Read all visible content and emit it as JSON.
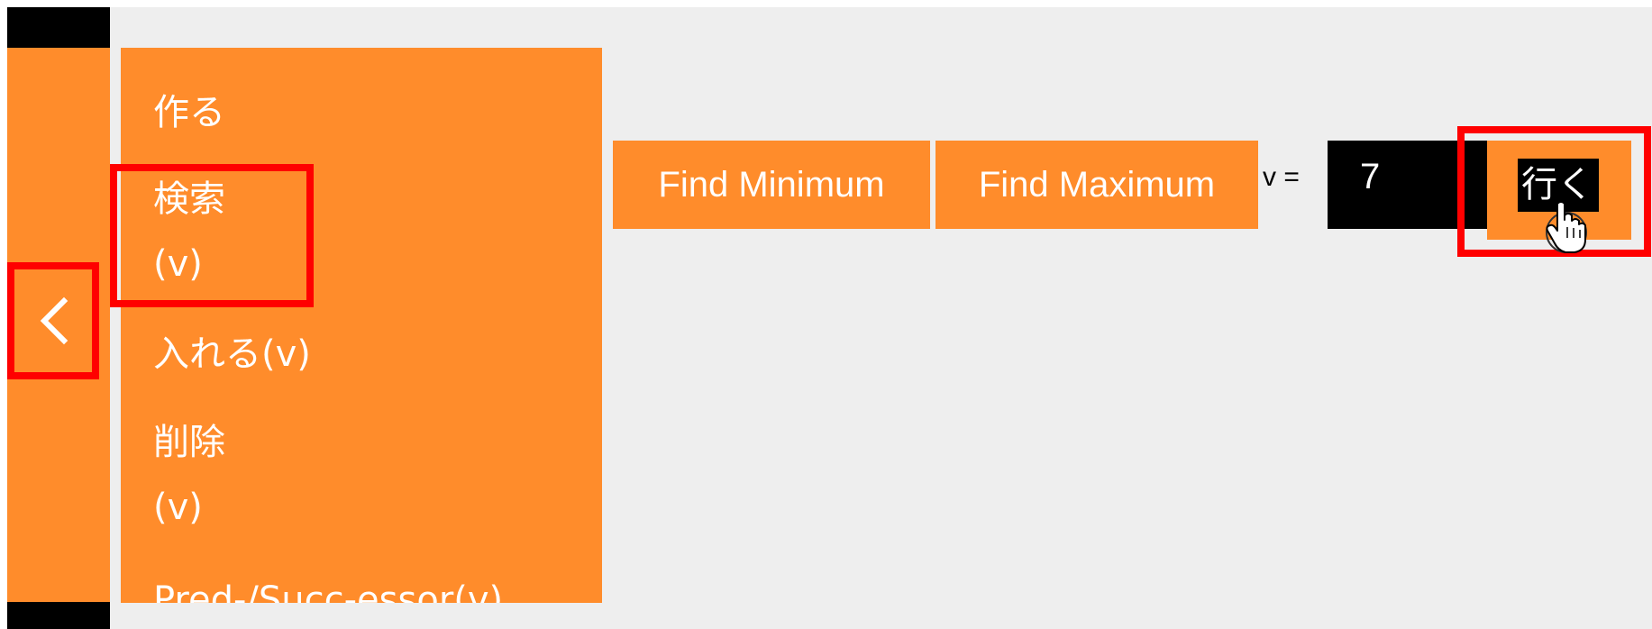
{
  "sidebar": {
    "collapse_icon": "chevron-left-icon",
    "menu": {
      "create": "作る",
      "search_line1": "検索",
      "search_line2": "(v)",
      "insert": "入れる(v)",
      "remove_line1": "削除",
      "remove_line2": "(v)",
      "pred_succ": "Pred-/Succ-essor(v)"
    }
  },
  "actions": {
    "find_minimum": "Find Minimum",
    "find_maximum": "Find Maximum"
  },
  "search_form": {
    "v_label": "v =",
    "v_value": "7",
    "go_label": "行く"
  },
  "colors": {
    "accent_orange": "#ff8c2b",
    "highlight_red": "#ff0000",
    "background": "#eeeeee",
    "input_black": "#000000"
  },
  "cursor_icon": "hand-pointer-icon"
}
